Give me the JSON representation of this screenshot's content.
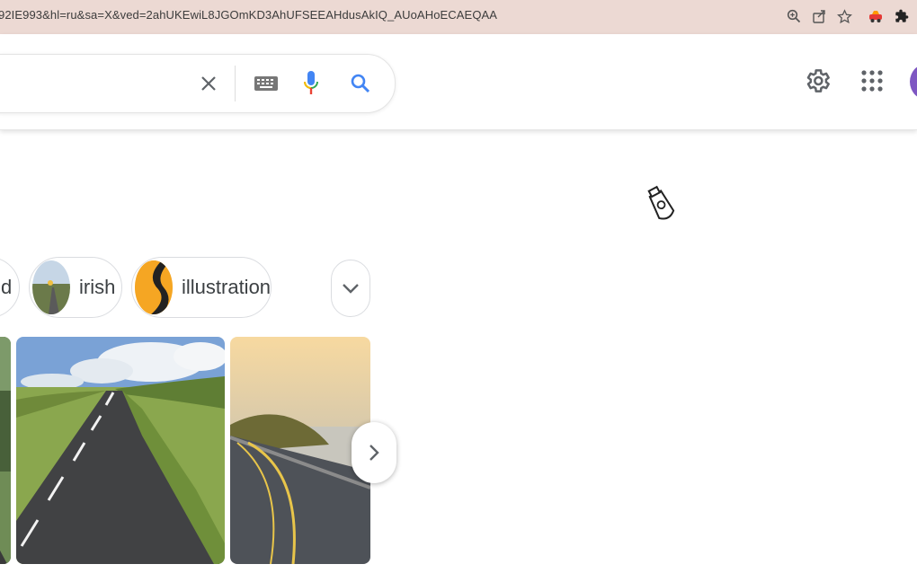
{
  "browser": {
    "url": "92IE993&hl=ru&sa=X&ved=2ahUKEwiL8JGOmKD3AhUFSEEAHdusAkIQ_AUoAHoECAEQAA",
    "icons": [
      "zoom-icon",
      "share-icon",
      "star-icon",
      "extension-car-icon",
      "puzzle-icon"
    ]
  },
  "header": {
    "icons": [
      "clear-icon",
      "keyboard-icon",
      "mic-icon",
      "search-icon",
      "gear-icon",
      "apps-icon"
    ]
  },
  "chips": [
    {
      "label": "d"
    },
    {
      "label": "irish"
    },
    {
      "label": "illustration"
    }
  ],
  "colors": {
    "address_bar": "#ecd9d3",
    "search_blue": "#4285f4",
    "chip_border": "#dadce0"
  }
}
